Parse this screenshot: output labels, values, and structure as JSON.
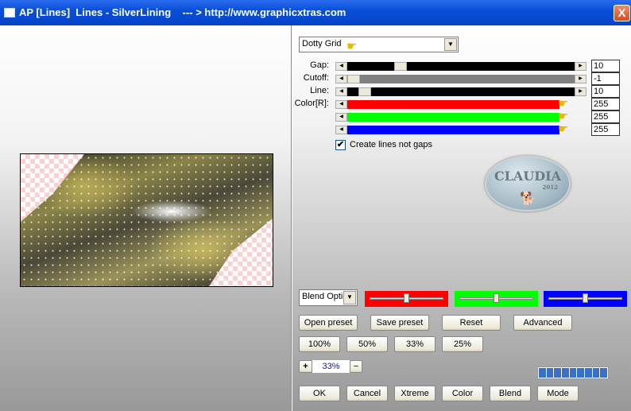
{
  "window": {
    "title": "AP [Lines]  Lines - SilverLining    --- > http://www.graphicxtras.com",
    "close": "X"
  },
  "preset_select": {
    "value": "Dotty Grid"
  },
  "sliders": [
    {
      "label": "Gap:",
      "value": "10",
      "position": 0.22,
      "track_color": "#000000"
    },
    {
      "label": "Cutoff:",
      "value": "-1",
      "position": 0.0,
      "track_color": "#808080"
    },
    {
      "label": "Line:",
      "value": "10",
      "position": 0.05,
      "track_color": "#000000"
    },
    {
      "label": "Color[R]:",
      "value": "255",
      "position": 1.0,
      "track_color": "#ff0000"
    },
    {
      "label": "",
      "value": "255",
      "position": 1.0,
      "track_color": "#00ff00"
    },
    {
      "label": "",
      "value": "255",
      "position": 1.0,
      "track_color": "#0000ff"
    }
  ],
  "checkbox": {
    "label": "Create lines not gaps",
    "checked": true
  },
  "logo": {
    "text": "CLAUDIA",
    "year": "2012"
  },
  "blend_select": {
    "value": "Blend Optio"
  },
  "color_sliders": [
    {
      "color": "#ff0000",
      "position": 0.5
    },
    {
      "color": "#00ff00",
      "position": 0.5
    },
    {
      "color": "#0000ff",
      "position": 0.5
    }
  ],
  "buttons_row1": [
    "Open preset",
    "Save preset",
    "Reset",
    "Advanced"
  ],
  "buttons_row2": [
    "100%",
    "50%",
    "33%",
    "25%"
  ],
  "zoom": {
    "plus": "+",
    "value": "33%",
    "minus": "−"
  },
  "progress": {
    "segments": 9,
    "fraction": 1.0
  },
  "buttons_row3": [
    "OK",
    "Cancel",
    "Xtreme",
    "Color",
    "Blend",
    "Mode"
  ]
}
